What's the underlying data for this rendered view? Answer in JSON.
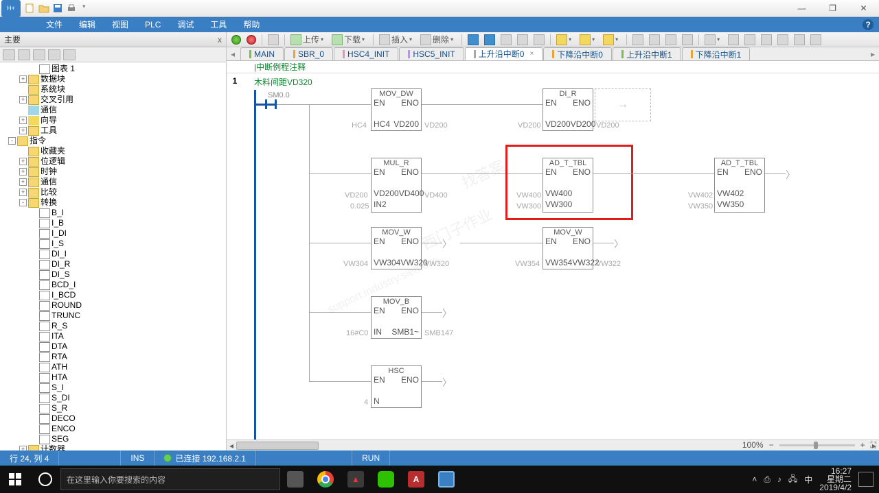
{
  "window": {
    "minimize": "—",
    "maximize": "❐",
    "close": "✕"
  },
  "menu": {
    "file": "文件",
    "edit": "编辑",
    "view": "视图",
    "plc": "PLC",
    "debug": "调试",
    "tools": "工具",
    "help": "帮助"
  },
  "panel": {
    "title": "主要",
    "close": "x"
  },
  "tree": {
    "items": [
      {
        "pad": 44,
        "exp": "",
        "ico": "page",
        "label": "图表 1"
      },
      {
        "pad": 28,
        "exp": "+",
        "ico": "folder",
        "label": "数据块"
      },
      {
        "pad": 28,
        "exp": "",
        "ico": "folder",
        "label": "系统块"
      },
      {
        "pad": 28,
        "exp": "+",
        "ico": "folder",
        "label": "交叉引用"
      },
      {
        "pad": 28,
        "exp": "",
        "ico": "cyan",
        "label": "通信"
      },
      {
        "pad": 28,
        "exp": "+",
        "ico": "yellow",
        "label": "向导"
      },
      {
        "pad": 28,
        "exp": "+",
        "ico": "folder",
        "label": "工具"
      },
      {
        "pad": 12,
        "exp": "-",
        "ico": "folder",
        "label": "指令"
      },
      {
        "pad": 28,
        "exp": "",
        "ico": "folder",
        "label": "收藏夹"
      },
      {
        "pad": 28,
        "exp": "+",
        "ico": "folder",
        "label": "位逻辑"
      },
      {
        "pad": 28,
        "exp": "+",
        "ico": "folder",
        "label": "时钟"
      },
      {
        "pad": 28,
        "exp": "+",
        "ico": "folder",
        "label": "通信"
      },
      {
        "pad": 28,
        "exp": "+",
        "ico": "folder",
        "label": "比较"
      },
      {
        "pad": 28,
        "exp": "-",
        "ico": "folder",
        "label": "转换"
      },
      {
        "pad": 44,
        "exp": "",
        "ico": "page",
        "label": "B_I"
      },
      {
        "pad": 44,
        "exp": "",
        "ico": "page",
        "label": "I_B"
      },
      {
        "pad": 44,
        "exp": "",
        "ico": "page",
        "label": "I_DI"
      },
      {
        "pad": 44,
        "exp": "",
        "ico": "page",
        "label": "I_S"
      },
      {
        "pad": 44,
        "exp": "",
        "ico": "page",
        "label": "DI_I"
      },
      {
        "pad": 44,
        "exp": "",
        "ico": "page",
        "label": "DI_R"
      },
      {
        "pad": 44,
        "exp": "",
        "ico": "page",
        "label": "DI_S"
      },
      {
        "pad": 44,
        "exp": "",
        "ico": "page",
        "label": "BCD_I"
      },
      {
        "pad": 44,
        "exp": "",
        "ico": "page",
        "label": "I_BCD"
      },
      {
        "pad": 44,
        "exp": "",
        "ico": "page",
        "label": "ROUND"
      },
      {
        "pad": 44,
        "exp": "",
        "ico": "page",
        "label": "TRUNC"
      },
      {
        "pad": 44,
        "exp": "",
        "ico": "page",
        "label": "R_S"
      },
      {
        "pad": 44,
        "exp": "",
        "ico": "page",
        "label": "ITA"
      },
      {
        "pad": 44,
        "exp": "",
        "ico": "page",
        "label": "DTA"
      },
      {
        "pad": 44,
        "exp": "",
        "ico": "page",
        "label": "RTA"
      },
      {
        "pad": 44,
        "exp": "",
        "ico": "page",
        "label": "ATH"
      },
      {
        "pad": 44,
        "exp": "",
        "ico": "page",
        "label": "HTA"
      },
      {
        "pad": 44,
        "exp": "",
        "ico": "page",
        "label": "S_I"
      },
      {
        "pad": 44,
        "exp": "",
        "ico": "page",
        "label": "S_DI"
      },
      {
        "pad": 44,
        "exp": "",
        "ico": "page",
        "label": "S_R"
      },
      {
        "pad": 44,
        "exp": "",
        "ico": "page",
        "label": "DECO"
      },
      {
        "pad": 44,
        "exp": "",
        "ico": "page",
        "label": "ENCO"
      },
      {
        "pad": 44,
        "exp": "",
        "ico": "page",
        "label": "SEG"
      },
      {
        "pad": 28,
        "exp": "+",
        "ico": "folder",
        "label": "计数器"
      }
    ]
  },
  "toolbar": {
    "upload": "上传",
    "download": "下载",
    "insert": "插入",
    "delete": "删除"
  },
  "tabs": [
    {
      "label": "MAIN",
      "color": "c-green",
      "active": false
    },
    {
      "label": "SBR_0",
      "color": "c-orange",
      "active": false
    },
    {
      "label": "HSC4_INIT",
      "color": "c-pink",
      "active": false
    },
    {
      "label": "HSC5_INIT",
      "color": "c-purple",
      "active": false
    },
    {
      "label": "上升沿中断0",
      "color": "",
      "active": true,
      "close": "×"
    },
    {
      "label": "下降沿中断0",
      "color": "c-orange",
      "active": false
    },
    {
      "label": "上升沿中断1",
      "color": "c-green",
      "active": false
    },
    {
      "label": "下降沿中断1",
      "color": "c-orange",
      "active": false
    }
  ],
  "comment_row": "中断例程注释",
  "network": {
    "num": "1",
    "title": "木料间距VD320"
  },
  "contact": "SM0.0",
  "blocks": {
    "mov_dw": {
      "title": "MOV_DW",
      "en": "EN",
      "eno": "ENO",
      "in_l": "HC4",
      "in_r": "VD200",
      "pin_l": "HC4",
      "pin_r": "VD200"
    },
    "di_r": {
      "title": "DI_R",
      "en": "EN",
      "eno": "ENO",
      "in_l": "VD200",
      "in_r": "VD200",
      "pin_l": "VD200",
      "pin_r": "VD200"
    },
    "mul_r": {
      "title": "MUL_R",
      "en": "EN",
      "eno": "ENO",
      "in_l": "VD200",
      "in_r": "VD400",
      "in2": "IN2",
      "pin_l": "VD200",
      "pin_l2": "0.025",
      "pin_r": "VD400"
    },
    "ad1": {
      "title": "AD_T_TBL",
      "en": "EN",
      "eno": "ENO",
      "in_l": "VW400",
      "in_l2": "VW300",
      "pin_l": "VW400",
      "pin_l2": "VW300"
    },
    "ad2": {
      "title": "AD_T_TBL",
      "en": "EN",
      "eno": "ENO",
      "in_l": "VW402",
      "in_l2": "VW350",
      "pin_l": "VW402",
      "pin_l2": "VW350"
    },
    "mov_w1": {
      "title": "MOV_W",
      "en": "EN",
      "eno": "ENO",
      "in_l": "VW304",
      "in_r": "VW320",
      "pin_l": "VW304",
      "pin_r": "VW320"
    },
    "mov_w2": {
      "title": "MOV_W",
      "en": "EN",
      "eno": "ENO",
      "in_l": "VW354",
      "in_r": "VW322",
      "pin_l": "VW354",
      "pin_r": "VW322"
    },
    "mov_b": {
      "title": "MOV_B",
      "en": "EN",
      "eno": "ENO",
      "in_l": "IN",
      "in_r": "SMB1~",
      "pin_l": "16#C0",
      "pin_r": "SMB147"
    },
    "hsc": {
      "title": "HSC",
      "en": "EN",
      "eno": "ENO",
      "in_l": "N",
      "pin_l": "4"
    }
  },
  "zoom": {
    "value": "100%",
    "page_btn": "⛶"
  },
  "status": {
    "pos": "行 24, 列 4",
    "ins": "INS",
    "conn": "已连接 192.168.2.1",
    "mode": "RUN"
  },
  "taskbar": {
    "search_placeholder": "在这里输入你要搜索的内容",
    "clock_time": "16:27",
    "clock_date": "2019/4/2",
    "clock_day": "星期二"
  },
  "watermarks": {
    "w1": "西门子作业",
    "w2": "找答案",
    "w3": "support.industry.siemens"
  }
}
